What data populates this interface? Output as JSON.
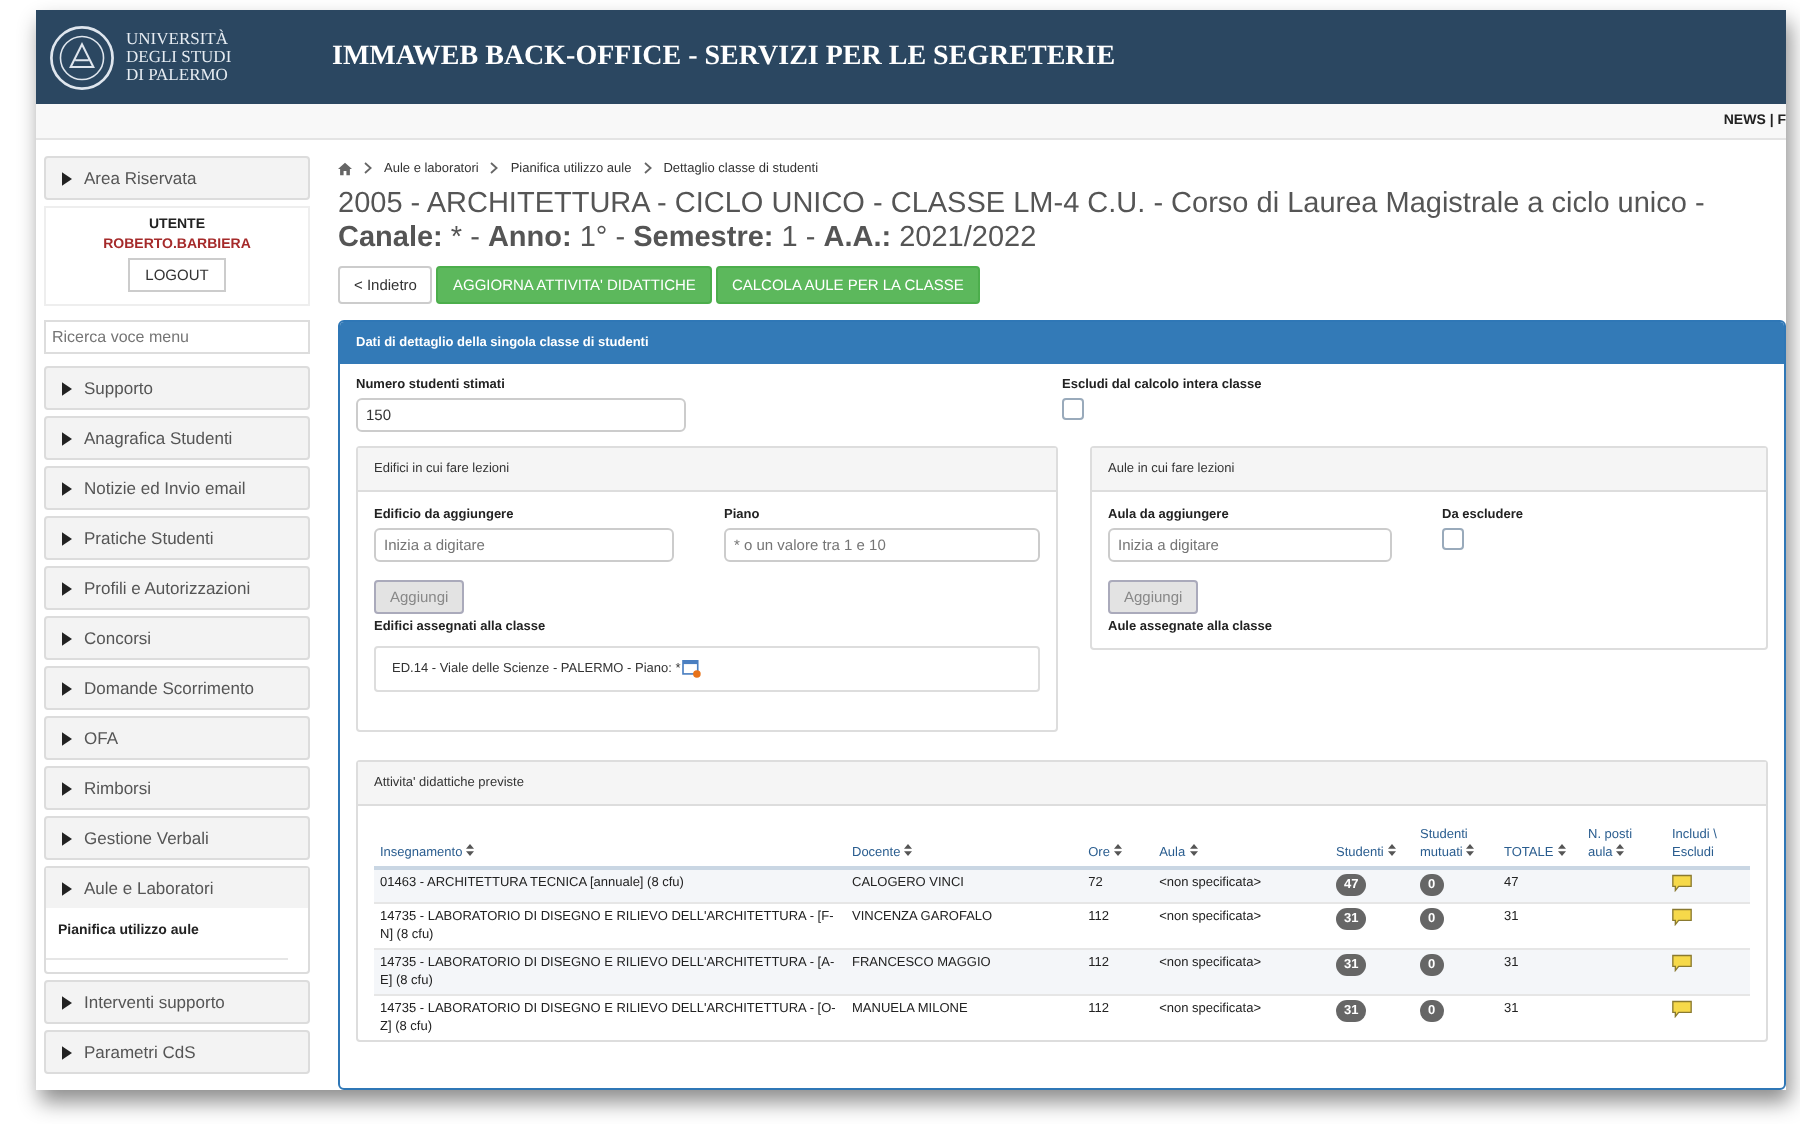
{
  "header": {
    "logo_text": [
      "UNIVERSITÀ",
      "DEGLI STUDI",
      "DI PALERMO"
    ],
    "title": "IMMAWEB BACK-OFFICE - SERVIZI PER LE SEGRETERIE"
  },
  "topbar": {
    "links": "NEWS | F"
  },
  "sidebar": {
    "area": "Area Riservata",
    "user_label": "UTENTE",
    "user_name": "ROBERTO.BARBIERA",
    "logout": "LOGOUT",
    "search_placeholder": "Ricerca voce menu",
    "items": [
      {
        "label": "Supporto",
        "expanded": false
      },
      {
        "label": "Anagrafica Studenti",
        "expanded": false
      },
      {
        "label": "Notizie ed Invio email",
        "expanded": false
      },
      {
        "label": "Pratiche Studenti",
        "expanded": false
      },
      {
        "label": "Profili e Autorizzazioni",
        "expanded": false
      },
      {
        "label": "Concorsi",
        "expanded": false
      },
      {
        "label": "Domande Scorrimento",
        "expanded": false
      },
      {
        "label": "OFA",
        "expanded": false
      },
      {
        "label": "Rimborsi",
        "expanded": false
      },
      {
        "label": "Gestione Verbali",
        "expanded": false
      },
      {
        "label": "Aule e Laboratori",
        "expanded": true,
        "children": [
          {
            "label": "Pianifica utilizzo aule"
          }
        ]
      },
      {
        "label": "Interventi supporto",
        "expanded": false
      },
      {
        "label": "Parametri CdS",
        "expanded": false
      }
    ]
  },
  "breadcrumb": [
    "Aule e laboratori",
    "Pianifica utilizzo aule",
    "Dettaglio classe di studenti"
  ],
  "page_title": "2005 - ARCHITETTURA - CICLO UNICO - CLASSE LM-4 C.U. - Corso di Laurea Magistrale a ciclo unico - **Canale:** * - **Anno:** 1° - **Semestre:** 1 - **A.A.:** 2021/2022",
  "actions": [
    {
      "label": "< Indietro",
      "kind": "default"
    },
    {
      "label": "AGGIORNA ATTIVITA' DIDATTICHE",
      "kind": "success"
    },
    {
      "label": "CALCOLA AULE PER LA CLASSE",
      "kind": "success"
    }
  ],
  "panel": {
    "title": "Dati di dettaglio della singola classe di studenti",
    "students_label": "Numero studenti stimati",
    "students_value": "150",
    "exclude_label": "Escludi dal calcolo intera classe",
    "exclude_checked": false,
    "buildings": {
      "title": "Edifici in cui fare lezioni",
      "building_label": "Edificio da aggiungere",
      "building_placeholder": "Inizia a digitare",
      "floor_label": "Piano",
      "floor_placeholder": "* o un valore tra 1 e 10",
      "add": "Aggiungi",
      "assigned_label": "Edifici assegnati alla classe",
      "assigned": [
        "ED.14 - Viale delle Scienze - PALERMO - Piano: *"
      ]
    },
    "rooms": {
      "title": "Aule in cui fare lezioni",
      "room_label": "Aula da aggiungere",
      "room_placeholder": "Inizia a digitare",
      "exclude_label": "Da escludere",
      "exclude_checked": false,
      "add": "Aggiungi",
      "assigned_label": "Aule assegnate alla classe"
    },
    "table": {
      "title": "Attivita' didattiche previste",
      "columns": [
        {
          "label": "Insegnamento",
          "sortable": true
        },
        {
          "label": "Docente",
          "sortable": true
        },
        {
          "label": "Ore",
          "sortable": true
        },
        {
          "label": "Aula",
          "sortable": true
        },
        {
          "label": "Studenti",
          "sortable": true
        },
        {
          "label": "Studenti mutuati",
          "sortable": true
        },
        {
          "label": "TOTALE",
          "sortable": true
        },
        {
          "label": "N. posti aula",
          "sortable": true
        },
        {
          "label": "Includi \\ Escludi",
          "sortable": false
        }
      ],
      "rows": [
        {
          "insegnamento": "01463 - ARCHITETTURA TECNICA [annuale] (8 cfu)",
          "docente": "CALOGERO VINCI",
          "ore": "72",
          "aula": "<non specificata>",
          "studenti": "47",
          "mutuati": "0",
          "totale": "47"
        },
        {
          "insegnamento": "14735 - LABORATORIO DI DISEGNO E RILIEVO DELL'ARCHITETTURA - [F-N] (8 cfu)",
          "docente": "VINCENZA GAROFALO",
          "ore": "112",
          "aula": "<non specificata>",
          "studenti": "31",
          "mutuati": "0",
          "totale": "31"
        },
        {
          "insegnamento": "14735 - LABORATORIO DI DISEGNO E RILIEVO DELL'ARCHITETTURA - [A-E] (8 cfu)",
          "docente": "FRANCESCO MAGGIO",
          "ore": "112",
          "aula": "<non specificata>",
          "studenti": "31",
          "mutuati": "0",
          "totale": "31"
        },
        {
          "insegnamento": "14735 - LABORATORIO DI DISEGNO E RILIEVO DELL'ARCHITETTURA - [O-Z] (8 cfu)",
          "docente": "MANUELA MILONE",
          "ore": "112",
          "aula": "<non specificata>",
          "studenti": "31",
          "mutuati": "0",
          "totale": "31"
        }
      ]
    }
  }
}
